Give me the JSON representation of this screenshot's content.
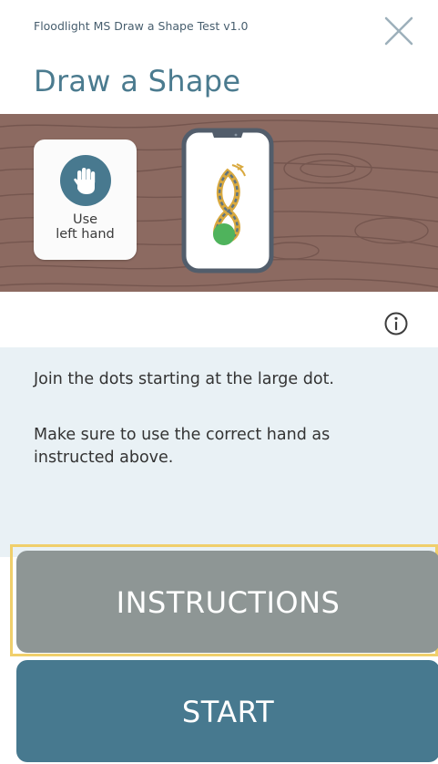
{
  "header": {
    "app_version": "Floodlight MS Draw a Shape Test v1.0",
    "close_icon": "close-icon",
    "title": "Draw a Shape"
  },
  "hero": {
    "hand_card": {
      "icon": "left-hand-icon",
      "line1": "Use",
      "line2": "left hand"
    },
    "phone_icon": "phone-figure-eight-icon"
  },
  "info_icon": "info-icon",
  "instructions": {
    "line1": "Join the dots starting at the large dot.",
    "line2": "Make sure to use the correct hand as instructed above."
  },
  "buttons": {
    "instructions_label": "INSTRUCTIONS",
    "start_label": "START"
  },
  "colors": {
    "accent": "#48798f",
    "title": "#4b7b8f",
    "instructions_button": "#8e9695",
    "start_button": "#47798f",
    "panel_bg": "#e9f1f5",
    "focus_ring": "#f0cf6b",
    "wood": "#8c6a61"
  }
}
